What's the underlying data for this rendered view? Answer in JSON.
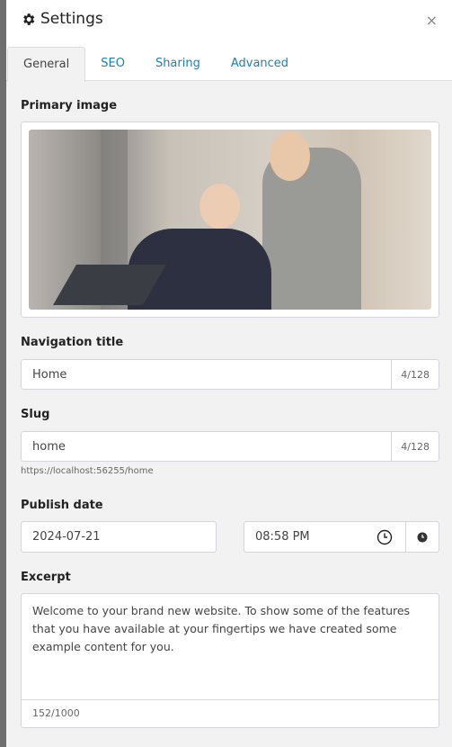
{
  "header": {
    "title": "Settings",
    "icon": "gear-icon",
    "close": "×"
  },
  "tabs": [
    {
      "label": "General",
      "active": true
    },
    {
      "label": "SEO"
    },
    {
      "label": "Sharing"
    },
    {
      "label": "Advanced"
    }
  ],
  "primary_image": {
    "label": "Primary image"
  },
  "navigation_title": {
    "label": "Navigation title",
    "value": "Home",
    "counter": "4/128"
  },
  "slug": {
    "label": "Slug",
    "value": "home",
    "counter": "4/128",
    "url": "https://localhost:56255/home"
  },
  "publish_date": {
    "label": "Publish date",
    "date": "2024-07-21",
    "time": "08:58 PM"
  },
  "excerpt": {
    "label": "Excerpt",
    "value": "Welcome to your brand new website. To show some of the features that you have available at your fingertips we have created some example content for you.",
    "counter": "152/1000"
  },
  "colors": {
    "accent": "#1a7fb0",
    "background": "#f2f2f2"
  }
}
